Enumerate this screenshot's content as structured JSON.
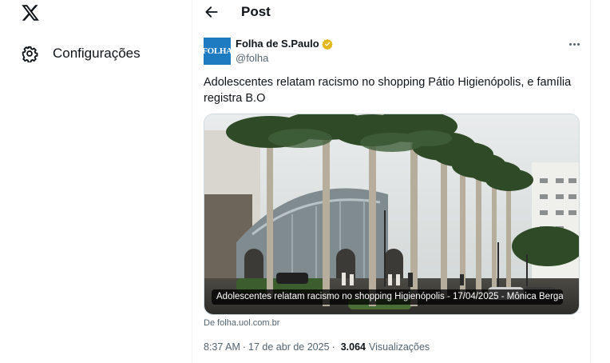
{
  "sidebar": {
    "logo_icon": "x-logo-icon",
    "settings_icon": "gear-icon",
    "settings_label": "Configurações"
  },
  "header": {
    "back_icon": "arrow-left-icon",
    "title": "Post"
  },
  "post": {
    "author": {
      "avatar_text": "FOLHA",
      "name": "Folha de S.Paulo",
      "verified_color": "#e2b719",
      "handle": "@folha"
    },
    "more_icon": "more-horizontal-icon",
    "text": "Adolescentes relatam racismo no shopping Pátio Higienópolis, e família registra B.O",
    "card": {
      "caption": "Adolescentes relatam racismo no shopping Higienópolis - 17/04/2025 - Mônica Berga...",
      "source": "De folha.uol.com.br"
    },
    "meta": {
      "time": "8:37 AM",
      "separator": "·",
      "date": "17 de abr de 2025",
      "views_count": "3.064",
      "views_label": "Visualizações"
    }
  },
  "colors": {
    "text_primary": "#0f1419",
    "text_secondary": "#536471",
    "border": "#cfd9de",
    "avatar_bg": "#1f7bc1"
  }
}
